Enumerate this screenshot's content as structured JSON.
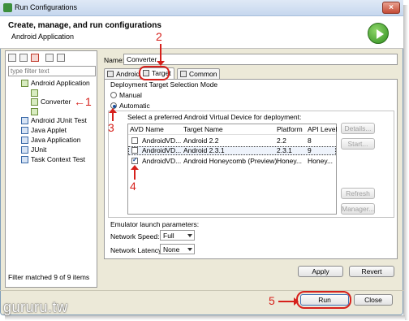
{
  "window": {
    "title": "Run Configurations"
  },
  "header": {
    "title": "Create, manage, and run configurations",
    "subtitle": "Android Application"
  },
  "left": {
    "filter_placeholder": "type filter text",
    "tree": [
      {
        "label": "Android Application",
        "level": 0
      },
      {
        "label": "",
        "level": 1
      },
      {
        "label": "Converter",
        "level": 1
      },
      {
        "label": "",
        "level": 1
      },
      {
        "label": "Android JUnit Test",
        "level": 0
      },
      {
        "label": "Java Applet",
        "level": 0
      },
      {
        "label": "Java Application",
        "level": 0
      },
      {
        "label": "JUnit",
        "level": 0
      },
      {
        "label": "Task Context Test",
        "level": 0
      }
    ],
    "status": "Filter matched 9 of 9 items"
  },
  "config": {
    "name_label": "Name:",
    "name_value": "Converter",
    "tabs": [
      "Android",
      "Target",
      "Common"
    ],
    "deploy_mode_label": "Deployment Target Selection Mode",
    "manual_label": "Manual",
    "automatic_label": "Automatic",
    "avd_prompt": "Select a preferred Android Virtual Device for deployment:",
    "columns": [
      "AVD Name",
      "Target Name",
      "Platform",
      "API Level"
    ],
    "rows": [
      {
        "name": "AndroidVD...",
        "target": "Android 2.2",
        "platform": "2.2",
        "api": "8",
        "checked": false
      },
      {
        "name": "AndroidVD...",
        "target": "Android 2.3.1",
        "platform": "2.3.1",
        "api": "9",
        "checked": false
      },
      {
        "name": "AndroidVD...",
        "target": "Android Honeycomb (Preview)",
        "platform": "Honey...",
        "api": "Honey...",
        "checked": true
      }
    ],
    "side_buttons": [
      "Details...",
      "Start...",
      "Refresh",
      "Manager..."
    ],
    "emulator_label": "Emulator launch parameters:",
    "network_speed_label": "Network Speed:",
    "network_speed_value": "Full",
    "network_latency_label": "Network Latency:",
    "network_latency_value": "None",
    "apply_label": "Apply",
    "revert_label": "Revert"
  },
  "footer": {
    "run_label": "Run",
    "close_label": "Close"
  },
  "annotations": [
    "1",
    "2",
    "3",
    "4",
    "5"
  ],
  "watermark": "gururu.tw",
  "colors": {
    "annotation_red": "#d6201b",
    "run_green": "#2f8f1f"
  }
}
